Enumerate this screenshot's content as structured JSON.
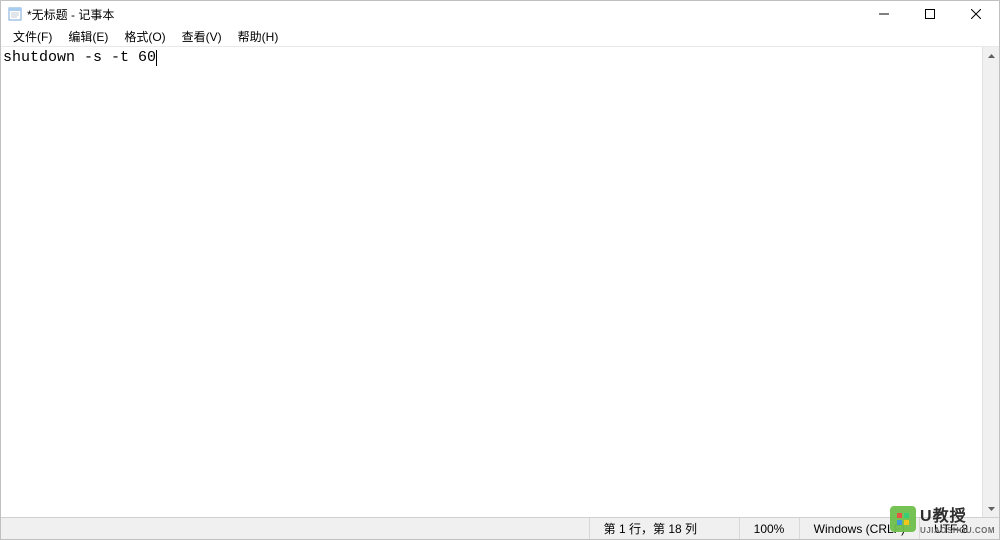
{
  "window": {
    "title": "*无标题 - 记事本"
  },
  "menu": {
    "items": [
      {
        "label": "文件(F)"
      },
      {
        "label": "编辑(E)"
      },
      {
        "label": "格式(O)"
      },
      {
        "label": "查看(V)"
      },
      {
        "label": "帮助(H)"
      }
    ]
  },
  "editor": {
    "content": "shutdown -s -t 60"
  },
  "statusbar": {
    "position": "第 1 行，第 18 列",
    "zoom": "100%",
    "line_ending": "Windows (CRLF)",
    "encoding": "UTF-8"
  },
  "watermark": {
    "main": "U教授",
    "sub": "UJIAOSHOU.COM"
  }
}
